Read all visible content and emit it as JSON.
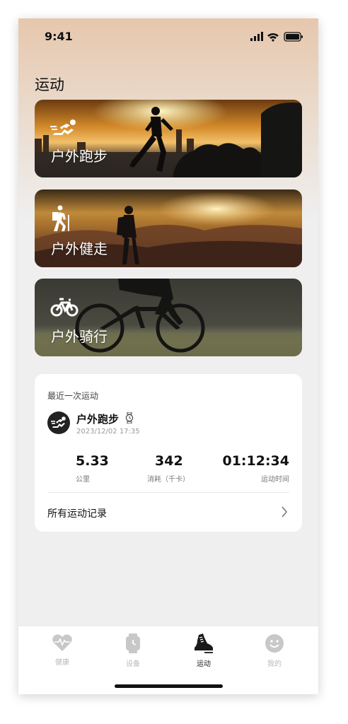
{
  "status_bar": {
    "time": "9:41"
  },
  "page": {
    "title": "运动"
  },
  "cards": [
    {
      "label": "户外跑步",
      "icon": "running-icon"
    },
    {
      "label": "户外健走",
      "icon": "hiking-icon"
    },
    {
      "label": "户外骑行",
      "icon": "bicycle-icon"
    }
  ],
  "recent": {
    "title": "最近一次运动",
    "activity": "户外跑步",
    "date": "2023/12/02 17:35",
    "stats": [
      {
        "value": "5.33",
        "label": "公里"
      },
      {
        "value": "342",
        "label": "消耗（千卡）"
      },
      {
        "value": "01:12:34",
        "label": "运动时间"
      }
    ],
    "all_records": "所有运动记录"
  },
  "tabs": [
    {
      "label": "健康",
      "icon": "heart-icon",
      "active": false
    },
    {
      "label": "设备",
      "icon": "watch-icon",
      "active": false
    },
    {
      "label": "运动",
      "icon": "shoe-icon",
      "active": true
    },
    {
      "label": "我的",
      "icon": "smiley-icon",
      "active": false
    }
  ],
  "colors": {
    "active_tab": "#222222",
    "inactive_tab": "#b9b9b9",
    "card_text": "#ffffff"
  }
}
